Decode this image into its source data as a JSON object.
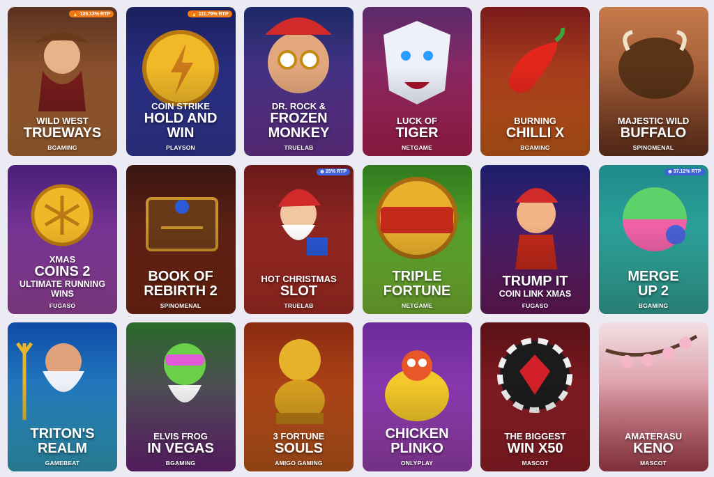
{
  "games": [
    {
      "line1": "WILD WEST",
      "line2": "TRUEWAYS",
      "line3": "",
      "provider": "BGAMING",
      "rtp": "126.13% RTP",
      "rtp_kind": "hot",
      "rtp_icon": "flame-icon",
      "art": "cowgirl",
      "bg": [
        "#5b3220",
        "#c7793c"
      ]
    },
    {
      "line1": "COIN STRIKE",
      "line2": "HOLD AND",
      "line3": "WIN",
      "provider": "PLAYSON",
      "rtp": "111.79% RTP",
      "rtp_kind": "hot",
      "rtp_icon": "flame-icon",
      "art": "coin-bolt",
      "bg": [
        "#1b1f5d",
        "#3a41b0"
      ]
    },
    {
      "line1": "DR. ROCK &",
      "line2": "FROZEN",
      "line3": "MONKEY",
      "provider": "TRUELAB",
      "rtp": "",
      "rtp_kind": "",
      "rtp_icon": "",
      "art": "monkey",
      "bg": [
        "#1c2a66",
        "#7a3aa8"
      ]
    },
    {
      "line1": "LUCK OF",
      "line2": "TIGER",
      "line3": "",
      "provider": "NETGAME",
      "rtp": "",
      "rtp_kind": "",
      "rtp_icon": "",
      "art": "tiger",
      "bg": [
        "#5a2a6a",
        "#c9245b"
      ]
    },
    {
      "line1": "BURNING",
      "line2": "CHILLI X",
      "line3": "",
      "provider": "BGAMING",
      "rtp": "",
      "rtp_kind": "",
      "rtp_icon": "",
      "art": "chilli",
      "bg": [
        "#7a1b1b",
        "#e86a1e"
      ]
    },
    {
      "line1": "MAJESTIC WILD",
      "line2": "BUFFALO",
      "line3": "",
      "provider": "SPINOMENAL",
      "rtp": "",
      "rtp_kind": "",
      "rtp_icon": "",
      "art": "buffalo",
      "bg": [
        "#c57a4a",
        "#7a3b22"
      ]
    },
    {
      "line1": "XMAS",
      "line2": "COINS 2",
      "line3": "ULTIMATE RUNNING WINS",
      "provider": "FUGASO",
      "rtp": "",
      "rtp_kind": "",
      "rtp_icon": "",
      "art": "snow-coin",
      "bg": [
        "#4a1f7a",
        "#b24fb8"
      ]
    },
    {
      "line1": "",
      "line2": "BOOK OF",
      "line3": "REBIRTH 2",
      "provider": "SPINOMENAL",
      "rtp": "",
      "rtp_kind": "",
      "rtp_icon": "",
      "art": "book",
      "bg": [
        "#3a1612",
        "#8a2d15"
      ]
    },
    {
      "line1": "HOT CHRISTMAS",
      "line2": "SLOT",
      "line3": "",
      "provider": "TRUELAB",
      "rtp": "25% RTP",
      "rtp_kind": "cold",
      "rtp_icon": "snowflake-icon",
      "art": "santa",
      "bg": [
        "#6a1a1a",
        "#c2342a"
      ]
    },
    {
      "line1": "",
      "line2": "TRIPLE",
      "line3": "FORTUNE",
      "provider": "NETGAME",
      "rtp": "",
      "rtp_kind": "",
      "rtp_icon": "",
      "art": "fortune",
      "bg": [
        "#2e7a1e",
        "#8bd23c"
      ]
    },
    {
      "line1": "",
      "line2": "TRUMP IT",
      "line3": "COIN LINK XMAS",
      "provider": "FUGASO",
      "rtp": "",
      "rtp_kind": "",
      "rtp_icon": "",
      "art": "trump",
      "bg": [
        "#1b1e6a",
        "#7a1e6a"
      ]
    },
    {
      "line1": "",
      "line2": "MERGE",
      "line3": "UP 2",
      "provider": "BGAMING",
      "rtp": "37.12% RTP",
      "rtp_kind": "cold",
      "rtp_icon": "snowflake-icon",
      "art": "merge",
      "bg": [
        "#1f8a8a",
        "#3bbfb0"
      ]
    },
    {
      "line1": "",
      "line2": "TRITON'S",
      "line3": "REALM",
      "provider": "GAMEBEAT",
      "rtp": "",
      "rtp_kind": "",
      "rtp_icon": "",
      "art": "triton",
      "bg": [
        "#0f4aa8",
        "#3ab7d8"
      ]
    },
    {
      "line1": "ELVIS FROG",
      "line2": "IN VEGAS",
      "line3": "",
      "provider": "BGAMING",
      "rtp": "",
      "rtp_kind": "",
      "rtp_icon": "",
      "art": "frog",
      "bg": [
        "#2a6a2a",
        "#7a2a8a"
      ]
    },
    {
      "line1": "3 FORTUNE",
      "line2": "SOULS",
      "line3": "",
      "provider": "AMIGO GAMING",
      "rtp": "",
      "rtp_kind": "",
      "rtp_icon": "",
      "art": "cat",
      "bg": [
        "#8a2a10",
        "#d8641f"
      ]
    },
    {
      "line1": "",
      "line2": "CHICKEN",
      "line3": "PLINKO",
      "provider": "ONLYPLAY",
      "rtp": "",
      "rtp_kind": "",
      "rtp_icon": "",
      "art": "chicken",
      "bg": [
        "#6a2a9a",
        "#b04ac8"
      ]
    },
    {
      "line1": "THE BIGGEST",
      "line2": "WIN X50",
      "line3": "",
      "provider": "MASCOT",
      "rtp": "",
      "rtp_kind": "",
      "rtp_icon": "",
      "art": "chip",
      "bg": [
        "#5a1216",
        "#a8242e"
      ]
    },
    {
      "line1": "AMATERASU",
      "line2": "KENO",
      "line3": "",
      "provider": "MASCOT",
      "rtp": "",
      "rtp_kind": "",
      "rtp_icon": "",
      "art": "blossom",
      "bg": [
        "#f2dfe4",
        "#c24a5a"
      ]
    }
  ]
}
